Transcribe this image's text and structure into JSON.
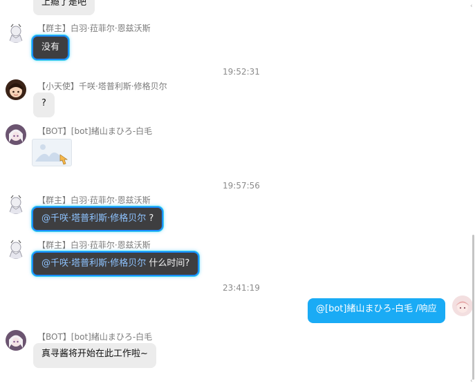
{
  "messages": [
    {
      "type": "partial",
      "text": "上瘾了是吧"
    },
    {
      "sender": "【群主】白羽·菈菲尔·恩兹沃斯",
      "text": "没有"
    },
    {
      "time": "19:52:31"
    },
    {
      "sender": "【小天使】千咲·塔普利斯·修格贝尔",
      "text": "?"
    },
    {
      "sender": "【BOT】[bot]緒山まひろ-白毛",
      "image": "image-placeholder"
    },
    {
      "time": "19:57:56"
    },
    {
      "sender": "【群主】白羽·菈菲尔·恩兹沃斯",
      "mention": "@千咲·塔普利斯·修格贝尔",
      "text": " ?"
    },
    {
      "sender": "【群主】白羽·菈菲尔·恩兹沃斯",
      "mention": "@千咲·塔普利斯·修格贝尔",
      "text": " 什么时间?"
    },
    {
      "time": "23:41:19"
    },
    {
      "self": true,
      "text": "@[bot]緒山まひろ-白毛 /响应"
    },
    {
      "sender": "【BOT】[bot]緒山まひろ-白毛",
      "text": "真寻酱将开始在此工作啦~"
    }
  ],
  "colors": {
    "self_bubble": "#1aabf5",
    "owner_bubble": "#3e3e40",
    "other_bubble": "#ececec",
    "mention": "#8ec3ff"
  }
}
